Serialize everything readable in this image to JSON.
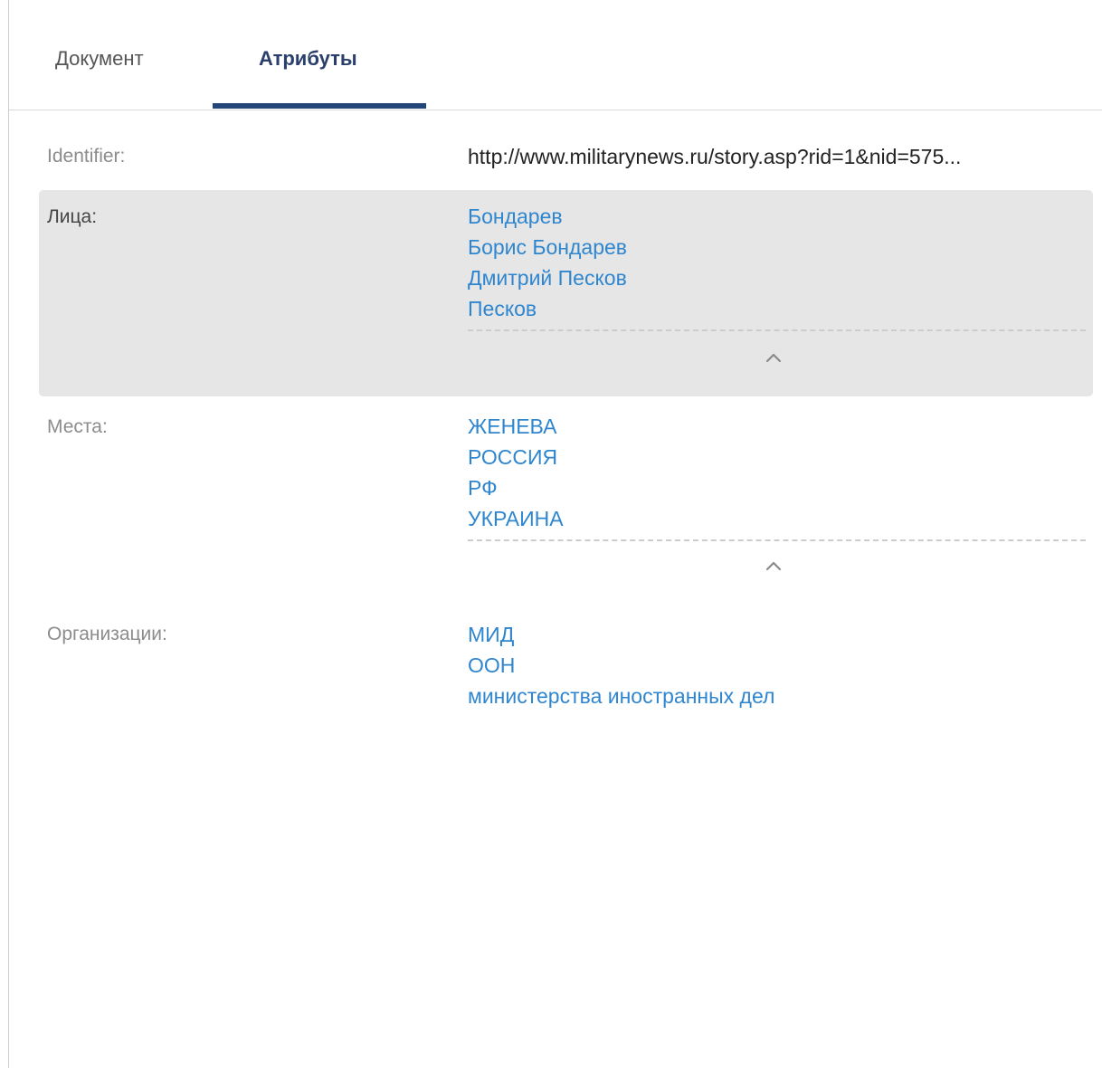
{
  "tabs": [
    {
      "label": "Документ",
      "active": false
    },
    {
      "label": "Атрибуты",
      "active": true
    }
  ],
  "attributes": {
    "identifier": {
      "label": "Identifier:",
      "value": "http://www.militarynews.ru/story.asp?rid=1&nid=575..."
    },
    "persons": {
      "label": "Лица:",
      "items": [
        "Бондарев",
        "Борис Бондарев",
        "Дмитрий Песков",
        "Песков"
      ],
      "collapse_icon": "chevron-up-icon"
    },
    "places": {
      "label": "Места:",
      "items": [
        "ЖЕНЕВА",
        "РОССИЯ",
        "РФ",
        "УКРАИНА"
      ],
      "collapse_icon": "chevron-up-icon"
    },
    "organizations": {
      "label": "Организации:",
      "items": [
        "МИД",
        "ООН",
        "министерства иностранных дел"
      ]
    }
  },
  "colors": {
    "link": "#2f86cf",
    "active_tab": "#23457a",
    "highlight_row": "#e6e6e6"
  }
}
